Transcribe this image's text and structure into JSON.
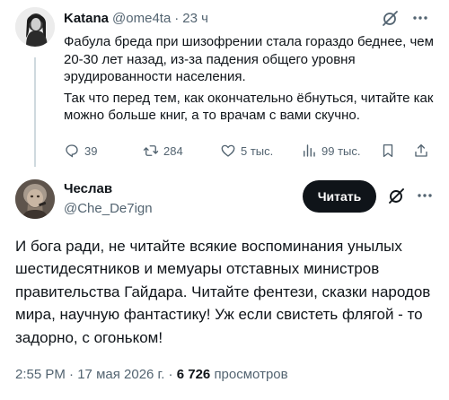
{
  "parent_tweet": {
    "author_name": "Katana",
    "author_handle": "@ome4ta",
    "separator": "·",
    "time_ago": "23 ч",
    "text_paragraphs": [
      "Фабула бреда при шизофрении стала гораздо беднее, чем 20-30 лет назад, из-за падения общего уровня эрудированности населения.",
      "Так что перед тем, как окончательно ёбнуться, читайте как можно больше книг, а то врачам с вами скучно."
    ],
    "stats": {
      "replies": "39",
      "reposts": "284",
      "likes": "5 тыс.",
      "views": "99 тыс."
    }
  },
  "main_tweet": {
    "author_name": "Чеслав",
    "author_handle": "@Che_De7ign",
    "follow_button_label": "Читать",
    "text": "И бога ради, не читайте всякие воспоминания унылых шестидесятников и мемуары отставных министров правительства Гайдара. Читайте фентези, сказки народов мира, научную фантастику! Уж если свистеть флягой - то задорно, с огоньком!",
    "time": "2:55 PM",
    "date": "17 мая 2026 г.",
    "views_count": "6 726",
    "views_label": "просмотров"
  },
  "colors": {
    "text_primary": "#0f1419",
    "text_secondary": "#536471",
    "thread_line": "#cfd9de",
    "button_bg": "#0f1419"
  }
}
